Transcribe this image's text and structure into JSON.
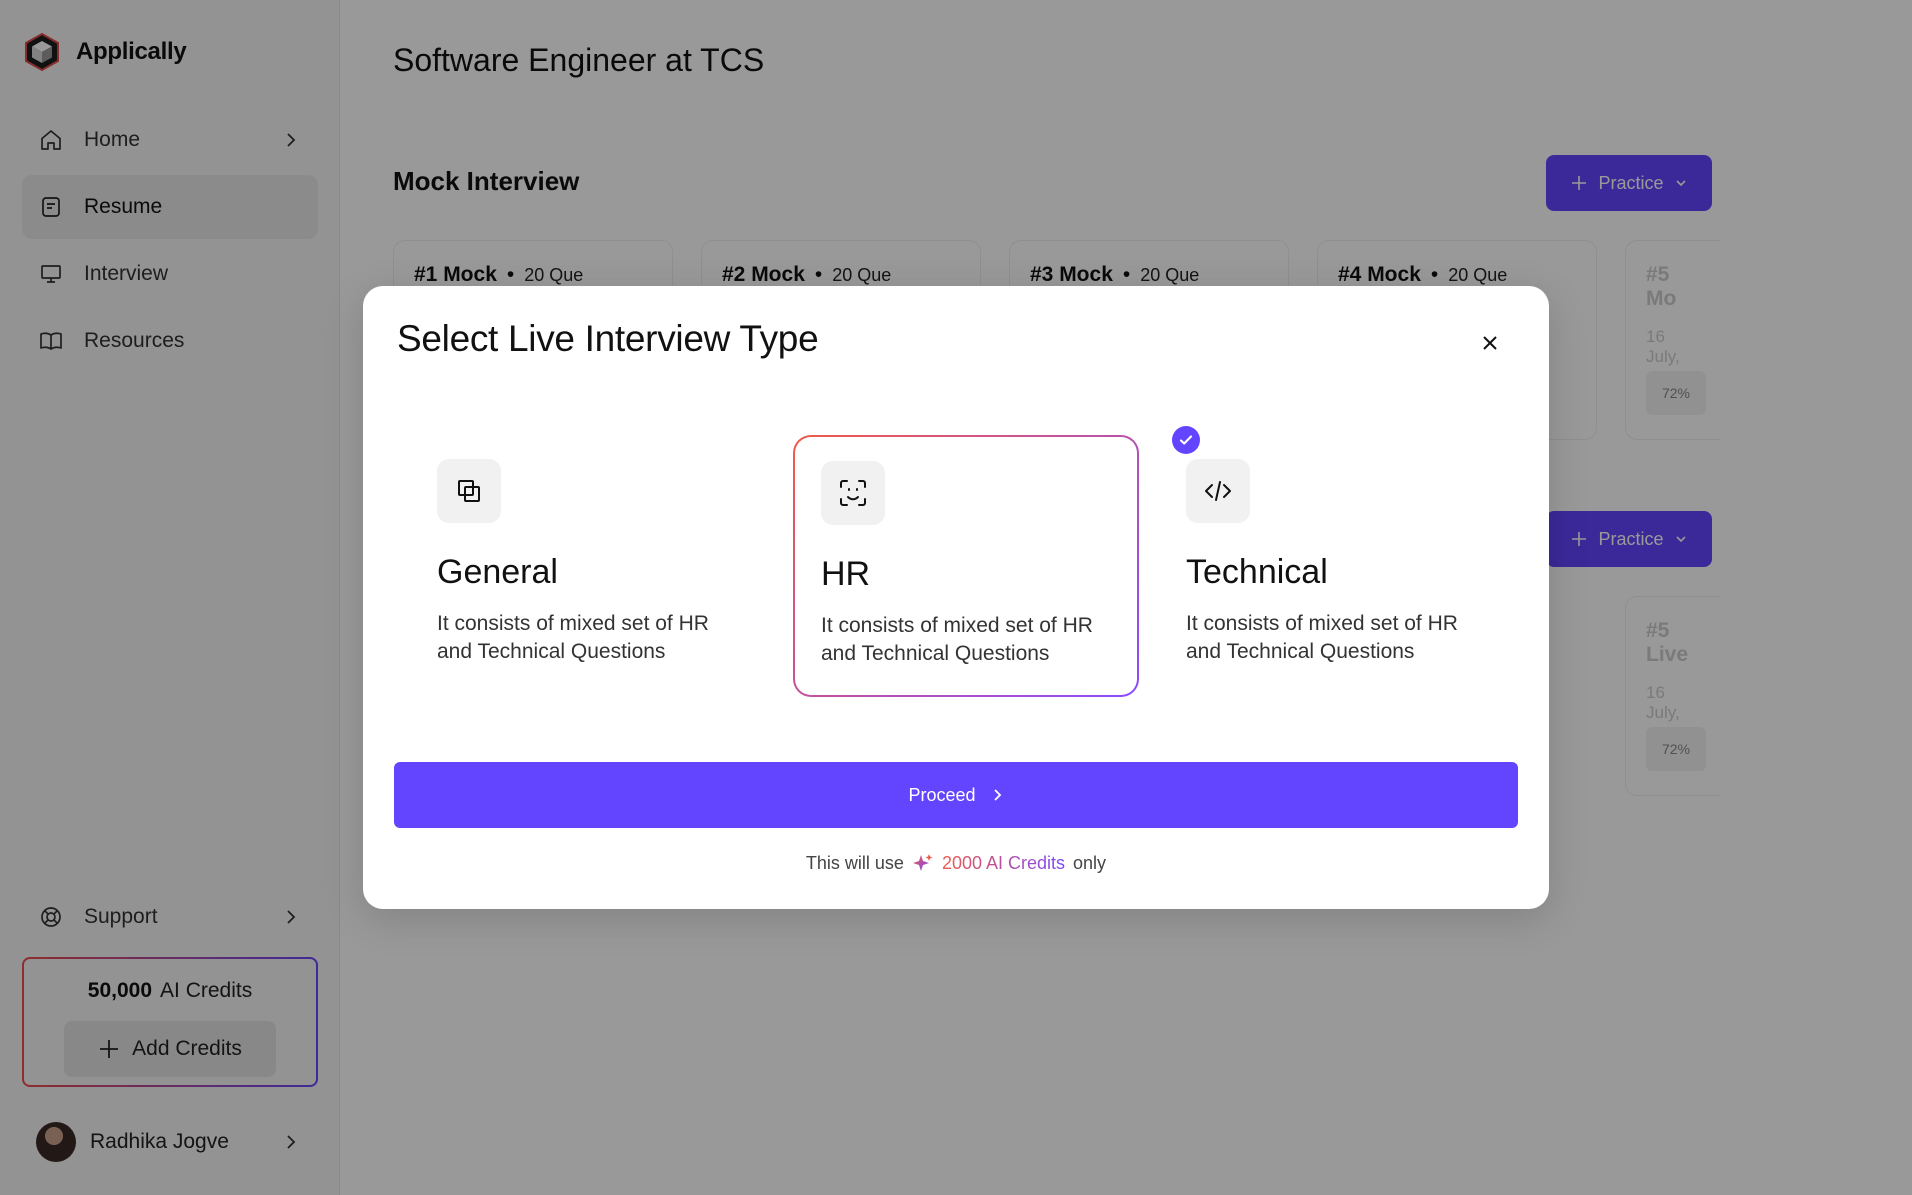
{
  "app": {
    "name": "Applically"
  },
  "sidebar": {
    "items": [
      {
        "label": "Home",
        "icon": "home-icon",
        "active": false,
        "chevron": true
      },
      {
        "label": "Resume",
        "icon": "document-icon",
        "active": true,
        "chevron": false
      },
      {
        "label": "Interview",
        "icon": "monitor-icon",
        "active": false,
        "chevron": false
      },
      {
        "label": "Resources",
        "icon": "book-icon",
        "active": false,
        "chevron": false
      }
    ],
    "support_label": "Support",
    "credits": {
      "amount": "50,000",
      "label": "AI Credits",
      "add_label": "Add Credits"
    },
    "user": {
      "name": "Radhika Jogve"
    }
  },
  "main": {
    "page_title": "Software Engineer at TCS",
    "section_title": "Mock Interview",
    "practice_label": "Practice",
    "cards": [
      {
        "title": "#1 Mock",
        "sub": "20 Que"
      },
      {
        "title": "#2 Mock",
        "sub": "20 Que"
      },
      {
        "title": "#3 Mock",
        "sub": "20 Que"
      },
      {
        "title": "#4 Mock",
        "sub": "20 Que"
      }
    ],
    "faded_cards": [
      {
        "title": "#5 Mo",
        "date": "16 July,",
        "pct": "72%"
      },
      {
        "title": "#5 Live",
        "date": "16 July,",
        "pct": "72%"
      }
    ]
  },
  "modal": {
    "title": "Select Live Interview Type",
    "options": [
      {
        "title": "General",
        "desc": "It consists of mixed set of HR and Technical Questions",
        "icon": "overlap-squares-icon"
      },
      {
        "title": "HR",
        "desc": "It consists of mixed set of HR and Technical Questions",
        "icon": "face-scan-icon"
      },
      {
        "title": "Technical",
        "desc": "It consists of mixed set of HR and Technical Questions",
        "icon": "code-icon"
      }
    ],
    "selected_option": "HR",
    "proceed_label": "Proceed",
    "note_prefix": "This will use",
    "note_amount": "2000 AI Credits",
    "note_suffix": "only"
  },
  "colors": {
    "accent": "#6445ff",
    "gradient_start": "#f05a4a",
    "gradient_end": "#8b4bff"
  }
}
